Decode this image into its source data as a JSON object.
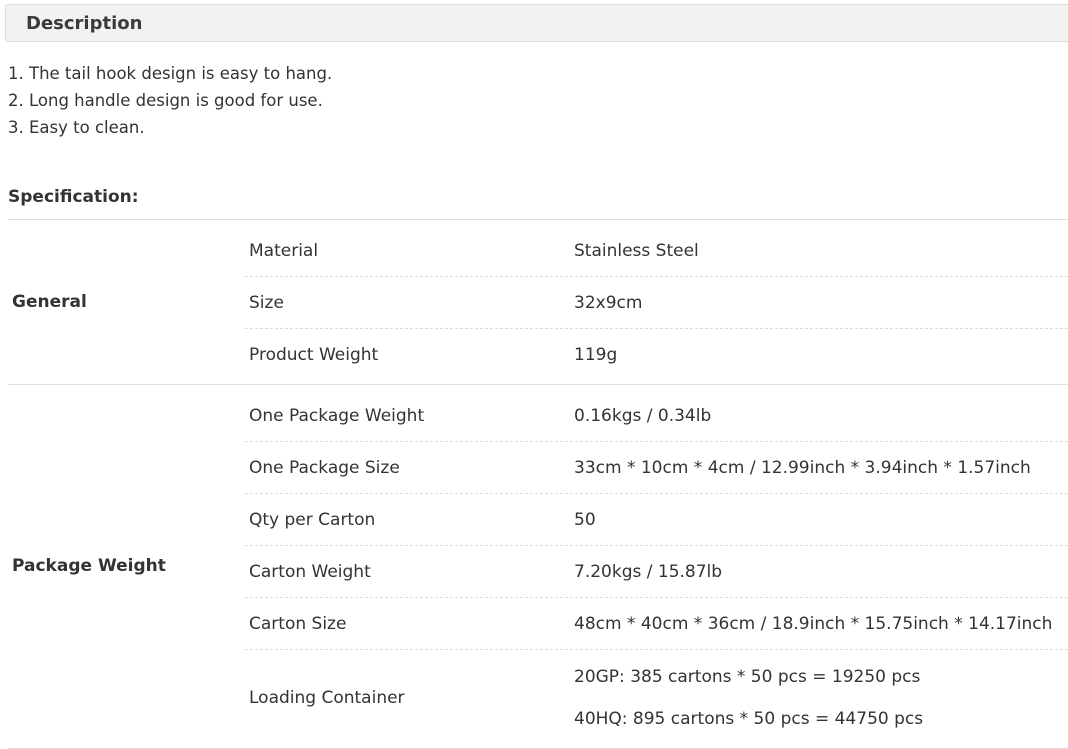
{
  "description": {
    "title": "Description",
    "items": [
      "1. The tail hook design is easy to hang.",
      "2. Long handle design is good for use.",
      "3. Easy to clean."
    ]
  },
  "specification": {
    "title": "Specification:",
    "sections": [
      {
        "label": "General",
        "rows": [
          {
            "key": "Material",
            "values": [
              "Stainless Steel"
            ]
          },
          {
            "key": "Size",
            "values": [
              "32x9cm"
            ]
          },
          {
            "key": "Product Weight",
            "values": [
              "119g"
            ]
          }
        ]
      },
      {
        "label": "Package Weight",
        "rows": [
          {
            "key": "One Package Weight",
            "values": [
              "0.16kgs / 0.34lb"
            ]
          },
          {
            "key": "One Package Size",
            "values": [
              "33cm * 10cm * 4cm / 12.99inch * 3.94inch * 1.57inch"
            ]
          },
          {
            "key": "Qty per Carton",
            "values": [
              "50"
            ]
          },
          {
            "key": "Carton Weight",
            "values": [
              "7.20kgs / 15.87lb"
            ]
          },
          {
            "key": "Carton Size",
            "values": [
              "48cm * 40cm * 36cm / 18.9inch * 15.75inch * 14.17inch"
            ]
          },
          {
            "key": "Loading Container",
            "values": [
              "20GP: 385 cartons * 50 pcs = 19250 pcs",
              "40HQ: 895 cartons * 50 pcs = 44750 pcs"
            ]
          }
        ]
      }
    ]
  }
}
